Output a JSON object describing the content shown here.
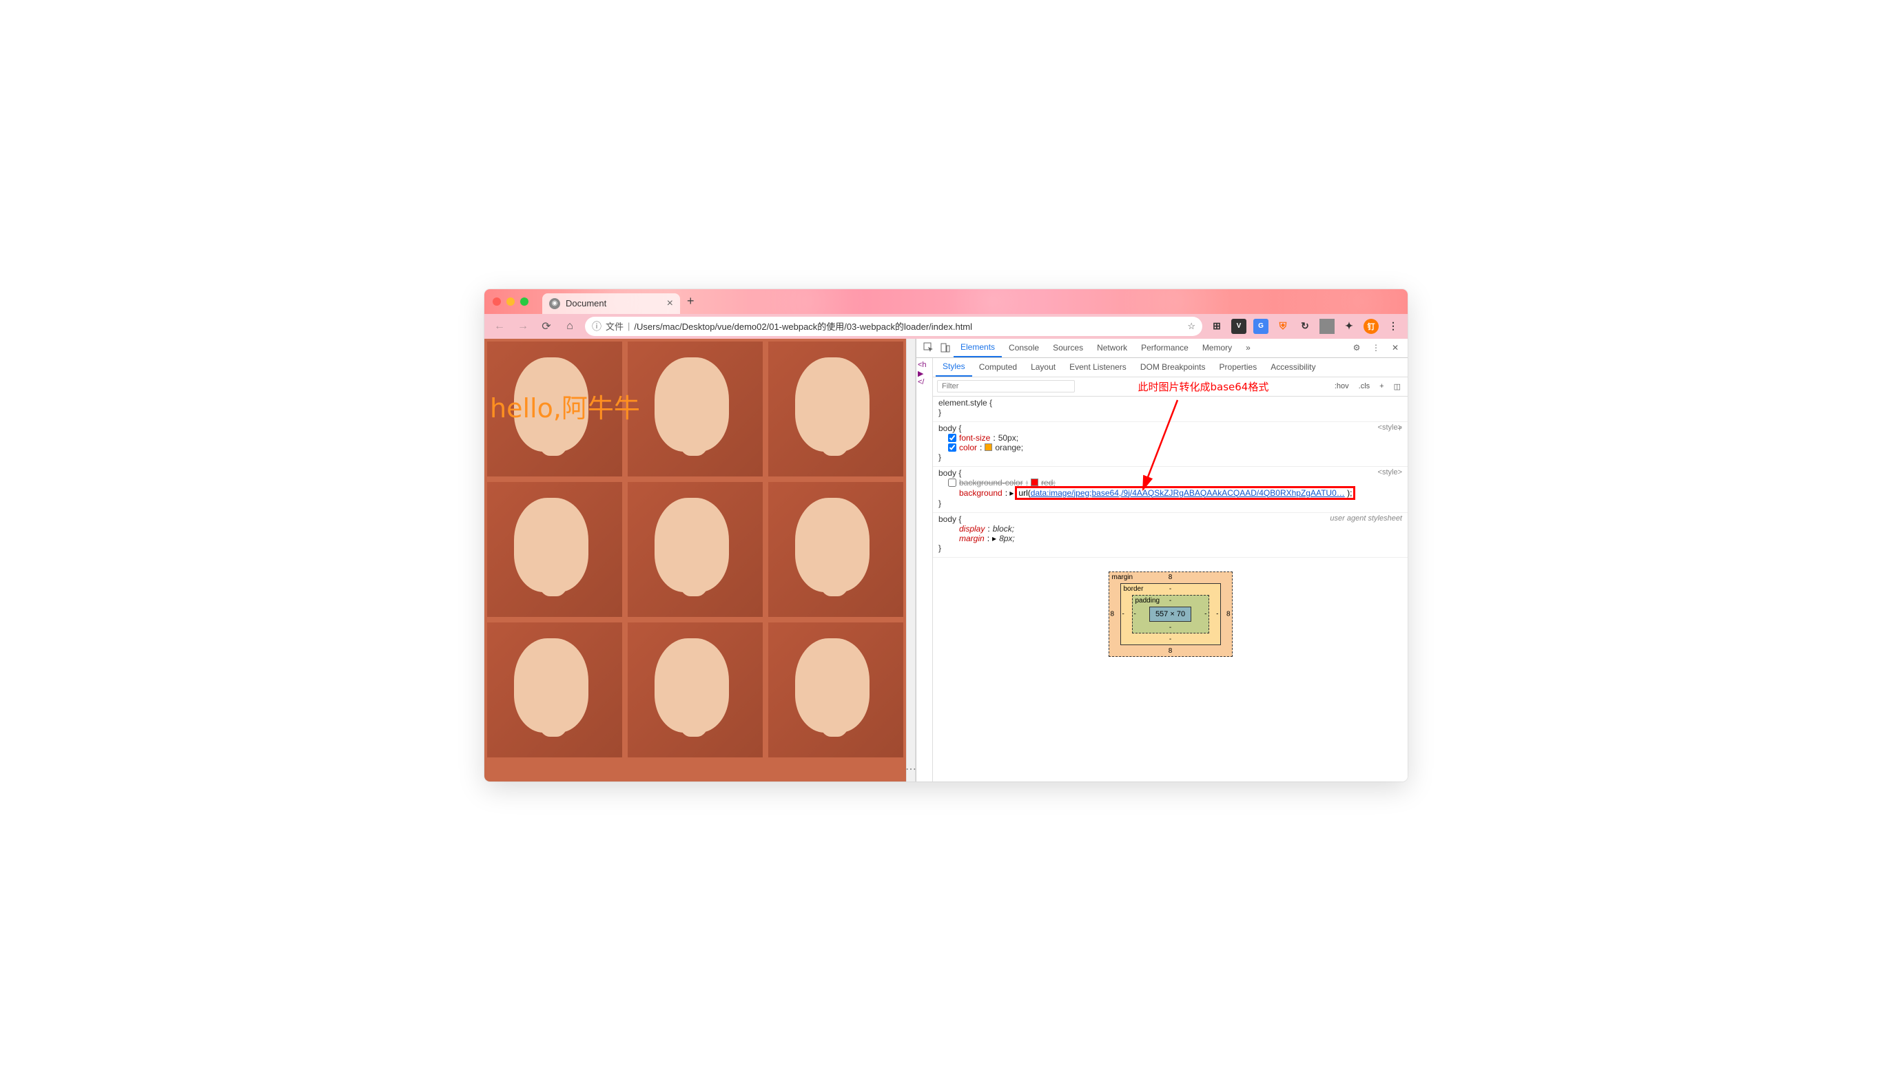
{
  "tab": {
    "title": "Document",
    "close": "×",
    "new": "+"
  },
  "url": {
    "scheme_label": "文件",
    "path": "/Users/mac/Desktop/vue/demo02/01-webpack的使用/03-webpack的loader/index.html"
  },
  "page": {
    "overlay_text": "hello,阿牛牛"
  },
  "devtools": {
    "tabs": [
      "Elements",
      "Console",
      "Sources",
      "Network",
      "Performance",
      "Memory"
    ],
    "more": "»",
    "elements_snippet": [
      "<h",
      "▶",
      "</"
    ],
    "styles_tabs": [
      "Styles",
      "Computed",
      "Layout",
      "Event Listeners",
      "DOM Breakpoints",
      "Properties",
      "Accessibility"
    ],
    "filter_placeholder": "Filter",
    "annotation": "此时图片转化成base64格式",
    "toggles": {
      "hov": ":hov",
      "cls": ".cls",
      "plus": "+"
    },
    "rules": {
      "r0": {
        "sel": "element.style {",
        "close": "}"
      },
      "r1": {
        "sel": "body {",
        "src": "<style>",
        "p1": {
          "prop": "font-size",
          "val": "50px;"
        },
        "p2": {
          "prop": "color",
          "val": "orange;",
          "swatch": "#ffa500"
        },
        "close": "}"
      },
      "r2": {
        "sel": "body {",
        "src": "<style>",
        "p1": {
          "prop": "background-color",
          "val": "red;",
          "swatch": "#ff0000"
        },
        "p2": {
          "prop": "background",
          "url_prefix": "url(",
          "url": "data:image/jpeg;base64,/9j/4AAQSkZJRgABAQAAkACQAAD/4QB0RXhpZgAATU0…",
          "url_suffix": " );"
        },
        "close": "}"
      },
      "r3": {
        "sel": "body {",
        "src": "user agent stylesheet",
        "p1": {
          "prop": "display",
          "val": "block;"
        },
        "p2": {
          "prop": "margin",
          "val": "8px;",
          "arrow": "▸"
        },
        "close": "}"
      }
    },
    "box_model": {
      "margin": {
        "label": "margin",
        "t": "8",
        "r": "8",
        "b": "8",
        "l": "8"
      },
      "border": {
        "label": "border",
        "t": "-",
        "r": "-",
        "b": "-",
        "l": "-"
      },
      "padding": {
        "label": "padding",
        "t": "-",
        "r": "-",
        "b": "-",
        "l": "-"
      },
      "content": "557 × 70"
    }
  }
}
